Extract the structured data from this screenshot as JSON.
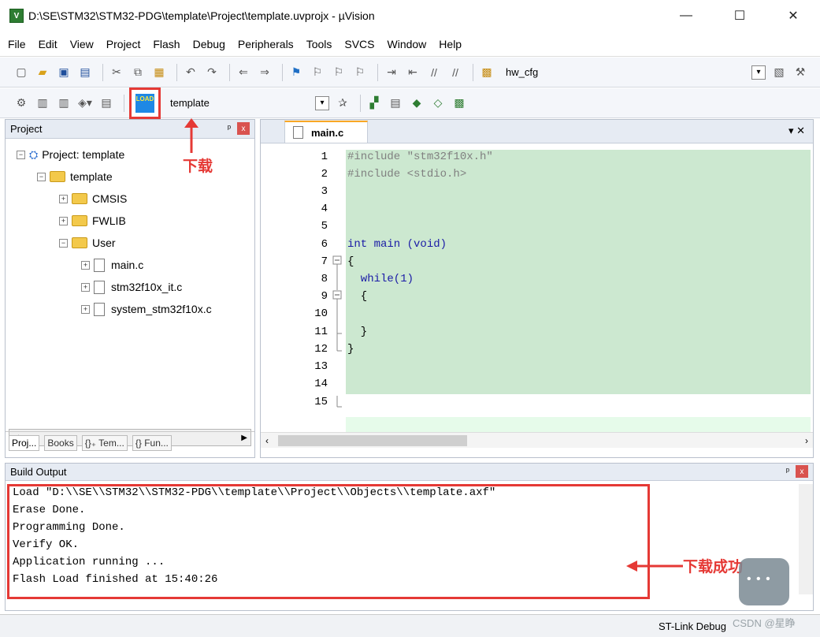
{
  "window": {
    "title": "D:\\SE\\STM32\\STM32-PDG\\template\\Project\\template.uvprojx - µVision",
    "app_icon": "V",
    "controls": [
      "—",
      "☐",
      "✕"
    ]
  },
  "menu": [
    "File",
    "Edit",
    "View",
    "Project",
    "Flash",
    "Debug",
    "Peripherals",
    "Tools",
    "SVCS",
    "Window",
    "Help"
  ],
  "toolbar1": {
    "combo_label": "hw_cfg"
  },
  "toolbar2": {
    "load_label": "LOAD",
    "target_combo": "template"
  },
  "project_panel": {
    "title": "Project",
    "pin": "ᵖ",
    "close": "x",
    "tree": [
      {
        "label": "Project: template"
      },
      {
        "label": "template"
      },
      {
        "label": "CMSIS"
      },
      {
        "label": "FWLIB"
      },
      {
        "label": "User"
      },
      {
        "label": "main.c"
      },
      {
        "label": "stm32f10x_it.c"
      },
      {
        "label": "system_stm32f10x.c"
      }
    ],
    "tabs": [
      "Proj...",
      "Books",
      "{}₊ Tem...",
      "{} Fun..."
    ]
  },
  "annotations": {
    "download": "下载",
    "download_success": "下载成功"
  },
  "editor": {
    "tab_label": "main.c",
    "tab_ctrls": "▾ ✕",
    "lines": [
      {
        "n": "1",
        "code": "#include \"stm32f10x.h\""
      },
      {
        "n": "2",
        "code": "#include <stdio.h>"
      },
      {
        "n": "3",
        "code": ""
      },
      {
        "n": "4",
        "code": ""
      },
      {
        "n": "5",
        "code": ""
      },
      {
        "n": "6",
        "code": "int main (void)"
      },
      {
        "n": "7",
        "code": "{"
      },
      {
        "n": "8",
        "code": "  while(1)"
      },
      {
        "n": "9",
        "code": "  {"
      },
      {
        "n": "10",
        "code": ""
      },
      {
        "n": "11",
        "code": "  }"
      },
      {
        "n": "12",
        "code": "}"
      },
      {
        "n": "13",
        "code": ""
      },
      {
        "n": "14",
        "code": ""
      },
      {
        "n": "15",
        "code": ""
      }
    ]
  },
  "build_output": {
    "title": "Build Output",
    "lines": [
      "Load \"D:\\\\SE\\\\STM32\\\\STM32-PDG\\\\template\\\\Project\\\\Objects\\\\template.axf\"",
      "Erase Done.",
      "Programming Done.",
      "Verify OK.",
      "Application running ...",
      "Flash Load finished at 15:40:26"
    ]
  },
  "status": {
    "mode": "ST-Link Debug"
  },
  "watermark": "CSDN @星睁"
}
